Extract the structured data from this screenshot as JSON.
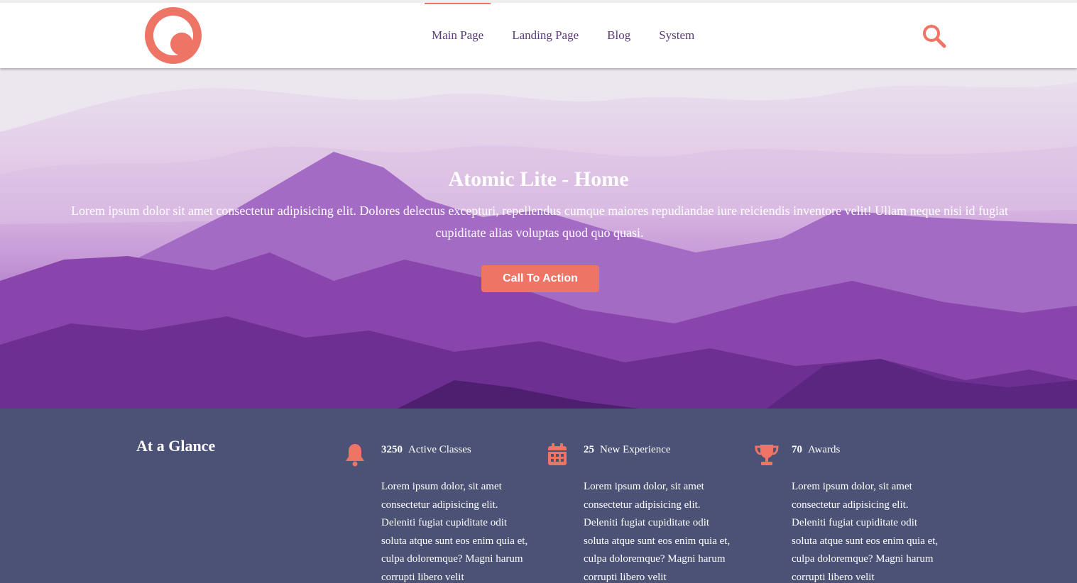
{
  "nav": {
    "items": [
      {
        "label": "Main Page"
      },
      {
        "label": "Landing Page"
      },
      {
        "label": "Blog"
      },
      {
        "label": "System"
      }
    ],
    "active_index": 0
  },
  "icons": {
    "logo": "concentric-circles-logo",
    "search": "search-icon",
    "feature_icons": [
      "bell-icon",
      "calendar-icon",
      "trophy-icon"
    ]
  },
  "hero": {
    "title": "Atomic Lite - Home",
    "text": "Lorem ipsum dolor sit amet consectetur adipisicing elit. Dolores delectus excepturi, repellendus cumque maiores repudiandae iure reiciendis inventore velit! Ullam neque nisi id fugiat cupiditate alias voluptas quod quo quasi.",
    "cta_label": "Call To Action"
  },
  "glance": {
    "title": "At a Glance",
    "features": [
      {
        "number": "3250",
        "label": "Active Classes",
        "text": "Lorem ipsum dolor, sit amet consectetur adipisicing elit. Deleniti fugiat cupiditate odit soluta atque sunt eos enim quia et, culpa doloremque? Magni harum corrupti libero velit"
      },
      {
        "number": "25",
        "label": "New Experience",
        "text": "Lorem ipsum dolor, sit amet consectetur adipisicing elit. Deleniti fugiat cupiditate odit soluta atque sunt eos enim quia et, culpa doloremque? Magni harum corrupti libero velit"
      },
      {
        "number": "70",
        "label": "Awards",
        "text": "Lorem ipsum dolor, sit amet consectetur adipisicing elit. Deleniti fugiat cupiditate odit soluta atque sunt eos enim quia et, culpa doloremque? Magni harum corrupti libero velit"
      }
    ]
  },
  "colors": {
    "accent": "#ee7465",
    "nav_text": "#5b3a7a",
    "glance_bg": "#4b5275"
  }
}
